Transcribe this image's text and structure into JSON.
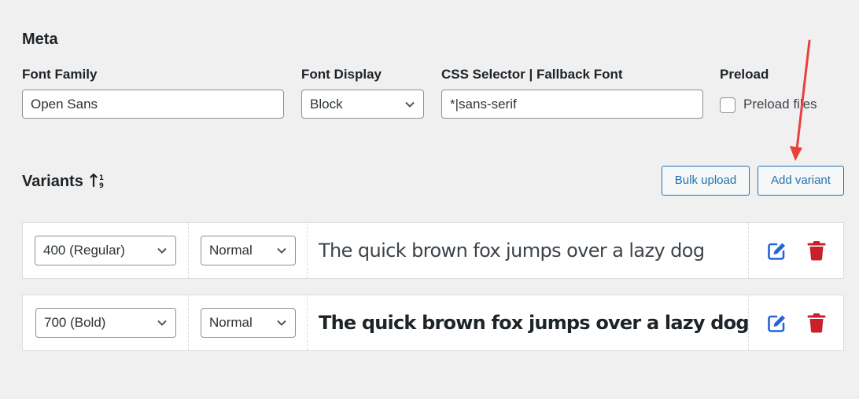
{
  "meta": {
    "title": "Meta",
    "font_family": {
      "label": "Font Family",
      "value": "Open Sans"
    },
    "font_display": {
      "label": "Font Display",
      "value": "Block"
    },
    "css_selector": {
      "label": "CSS Selector | Fallback Font",
      "value": "*|sans-serif"
    },
    "preload": {
      "label": "Preload",
      "checkbox_label": "Preload files",
      "checked": false
    }
  },
  "variants": {
    "title": "Variants",
    "sort_icon": "sort-numeric-icon",
    "bulk_upload_label": "Bulk upload",
    "add_variant_label": "Add variant",
    "rows": [
      {
        "weight": "400 (Regular)",
        "style": "Normal",
        "preview": "The quick brown fox jumps over a lazy dog"
      },
      {
        "weight": "700 (Bold)",
        "style": "Normal",
        "preview": "The quick brown fox jumps over a lazy dog"
      }
    ]
  },
  "colors": {
    "accent": "#2271b1",
    "edit_icon": "#2563d8",
    "delete_icon": "#c9202a",
    "annotation_arrow": "#e8413a"
  }
}
